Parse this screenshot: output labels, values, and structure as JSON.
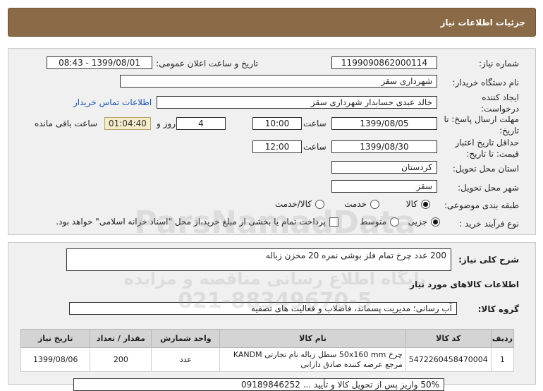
{
  "header": {
    "title": "جزئیات اطلاعات نیاز"
  },
  "form": {
    "need_number_label": "شماره نیاز:",
    "need_number": "1199090862000114",
    "announce_label": "تاریخ و ساعت اعلان عمومی:",
    "announce_value": "1399/08/01 - 08:43",
    "buyer_org_label": "نام دستگاه خریدار:",
    "buyer_org": "شهرداری سقز",
    "creator_label": "ایجاد کننده درخواست:",
    "creator": "خالد عبدی حسابدار شهرداری سقز",
    "contact_link": "اطلاعات تماس خریدار",
    "deadline_label": "مهلت ارسال پاسخ: تا تاریخ:",
    "deadline_date": "1399/08/05",
    "time_label": "ساعت",
    "deadline_time": "10:00",
    "days_value": "4",
    "days_label": "روز و",
    "remaining_time": "01:04:40",
    "remaining_label": "ساعت باقی مانده",
    "validity_label": "حداقل تاریخ اعتبار قیمت: تا تاریخ:",
    "validity_date": "1399/08/30",
    "validity_time": "12:00",
    "province_label": "استان محل تحویل:",
    "province": "کردستان",
    "city_label": "شهر محل تحویل:",
    "city": "سقز",
    "category_label": "طبقه بندی موضوعی:",
    "category_options": [
      "کالا",
      "خدمت",
      "کالا/خدمت"
    ],
    "process_label": "نوع فرآیند خرید :",
    "process_options": [
      "جزیی",
      "متوسط"
    ],
    "payment_note": "پرداخت تمام یا بخشی از مبلغ خرید،از محل \"اسناد خزانه اسلامی\" خواهد بود."
  },
  "summary": {
    "label": "شرح کلی نیاز:",
    "text": "200 عدد چرخ تمام فلز بوشی نمره 20 مخزن زباله"
  },
  "goods": {
    "section_title": "اطلاعات کالاهای مورد نیاز",
    "group_label": "گروه کالا:",
    "group_value": "آب رسانی؛ مدیریت پسماند، فاضلاب و فعالیت های تصفیه",
    "columns": [
      "ردیف",
      "کد کالا",
      "نام کالا",
      "واحد شمارش",
      "مقدار / تعداد",
      "تاریخ نیاز"
    ],
    "rows": [
      {
        "index": "1",
        "code": "5472260458470004",
        "name": "چرخ 50x160 mm سطل زباله نام تجارتی KANDM مرجع عرضه کننده صادق دارابی",
        "unit": "عدد",
        "qty": "200",
        "date": "1399/08/06"
      }
    ]
  },
  "footer_note": "50% واریز پس از تحویل کالا و تأیید ... 09189846252",
  "watermark": {
    "line1": "ParsNamadData",
    "line2": "پایگاه اطلاع رسانی مناقصه و مزایده",
    "line3": "021-88349670-5"
  }
}
